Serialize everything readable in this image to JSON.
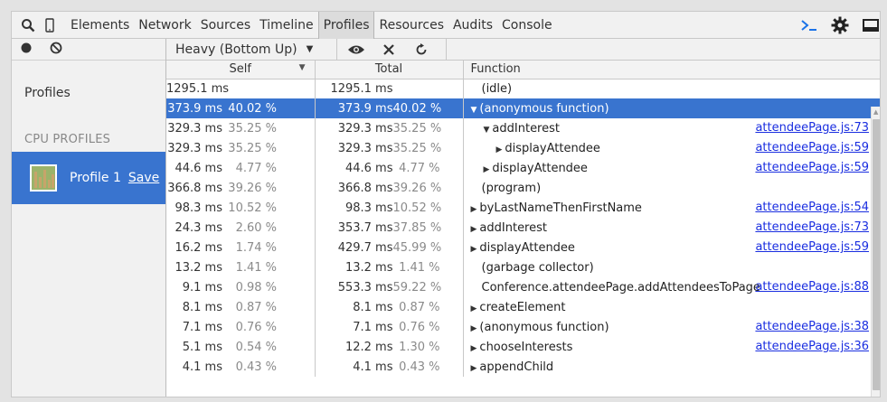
{
  "toolbar": {
    "search_icon": "search-icon",
    "device_icon": "device-icon",
    "tabs": [
      {
        "label": "Elements"
      },
      {
        "label": "Network"
      },
      {
        "label": "Sources"
      },
      {
        "label": "Timeline"
      },
      {
        "label": "Profiles"
      },
      {
        "label": "Resources"
      },
      {
        "label": "Audits"
      },
      {
        "label": "Console"
      }
    ],
    "active_tab": "Profiles",
    "right_icons": [
      "console-drawer-icon",
      "gear-icon",
      "dock-icon"
    ]
  },
  "left_panel": {
    "title": "Profiles",
    "section": "CPU PROFILES",
    "profile": {
      "name": "Profile 1",
      "save_label": "Save"
    }
  },
  "subbar": {
    "view_mode": "Heavy (Bottom Up)",
    "icons": [
      "eye-icon",
      "close-icon",
      "reload-icon"
    ]
  },
  "table": {
    "headers": {
      "self": "Self",
      "total": "Total",
      "function": "Function"
    },
    "rows": [
      {
        "self_ms": "1295.1 ms",
        "self_pct": "",
        "total_ms": "1295.1 ms",
        "total_pct": "",
        "arrow": "",
        "indent": 0,
        "func": "(idle)",
        "link": ""
      },
      {
        "self_ms": "373.9 ms",
        "self_pct": "40.02 %",
        "total_ms": "373.9 ms",
        "total_pct": "40.02 %",
        "arrow": "▼",
        "indent": 0,
        "func": "(anonymous function)",
        "link": "",
        "selected": true
      },
      {
        "self_ms": "329.3 ms",
        "self_pct": "35.25 %",
        "total_ms": "329.3 ms",
        "total_pct": "35.25 %",
        "arrow": "▼",
        "indent": 1,
        "func": "addInterest",
        "link": "attendeePage.js:73"
      },
      {
        "self_ms": "329.3 ms",
        "self_pct": "35.25 %",
        "total_ms": "329.3 ms",
        "total_pct": "35.25 %",
        "arrow": "▶",
        "indent": 2,
        "func": "displayAttendee",
        "link": "attendeePage.js:59"
      },
      {
        "self_ms": "44.6 ms",
        "self_pct": "4.77 %",
        "total_ms": "44.6 ms",
        "total_pct": "4.77 %",
        "arrow": "▶",
        "indent": 1,
        "func": "displayAttendee",
        "link": "attendeePage.js:59"
      },
      {
        "self_ms": "366.8 ms",
        "self_pct": "39.26 %",
        "total_ms": "366.8 ms",
        "total_pct": "39.26 %",
        "arrow": "",
        "indent": 0,
        "func": "(program)",
        "link": ""
      },
      {
        "self_ms": "98.3 ms",
        "self_pct": "10.52 %",
        "total_ms": "98.3 ms",
        "total_pct": "10.52 %",
        "arrow": "▶",
        "indent": 0,
        "func": "byLastNameThenFirstName",
        "link": "attendeePage.js:54"
      },
      {
        "self_ms": "24.3 ms",
        "self_pct": "2.60 %",
        "total_ms": "353.7 ms",
        "total_pct": "37.85 %",
        "arrow": "▶",
        "indent": 0,
        "func": "addInterest",
        "link": "attendeePage.js:73"
      },
      {
        "self_ms": "16.2 ms",
        "self_pct": "1.74 %",
        "total_ms": "429.7 ms",
        "total_pct": "45.99 %",
        "arrow": "▶",
        "indent": 0,
        "func": "displayAttendee",
        "link": "attendeePage.js:59"
      },
      {
        "self_ms": "13.2 ms",
        "self_pct": "1.41 %",
        "total_ms": "13.2 ms",
        "total_pct": "1.41 %",
        "arrow": "",
        "indent": 0,
        "func": "(garbage collector)",
        "link": ""
      },
      {
        "self_ms": "9.1 ms",
        "self_pct": "0.98 %",
        "total_ms": "553.3 ms",
        "total_pct": "59.22 %",
        "arrow": "",
        "indent": 0,
        "func": "Conference.attendeePage.addAttendeesToPage",
        "link": "attendeePage.js:88"
      },
      {
        "self_ms": "8.1 ms",
        "self_pct": "0.87 %",
        "total_ms": "8.1 ms",
        "total_pct": "0.87 %",
        "arrow": "▶",
        "indent": 0,
        "func": "createElement",
        "link": ""
      },
      {
        "self_ms": "7.1 ms",
        "self_pct": "0.76 %",
        "total_ms": "7.1 ms",
        "total_pct": "0.76 %",
        "arrow": "▶",
        "indent": 0,
        "func": "(anonymous function)",
        "link": "attendeePage.js:38"
      },
      {
        "self_ms": "5.1 ms",
        "self_pct": "0.54 %",
        "total_ms": "12.2 ms",
        "total_pct": "1.30 %",
        "arrow": "▶",
        "indent": 0,
        "func": "chooseInterests",
        "link": "attendeePage.js:36"
      },
      {
        "self_ms": "4.1 ms",
        "self_pct": "0.43 %",
        "total_ms": "4.1 ms",
        "total_pct": "0.43 %",
        "arrow": "▶",
        "indent": 0,
        "func": "appendChild",
        "link": ""
      }
    ]
  }
}
